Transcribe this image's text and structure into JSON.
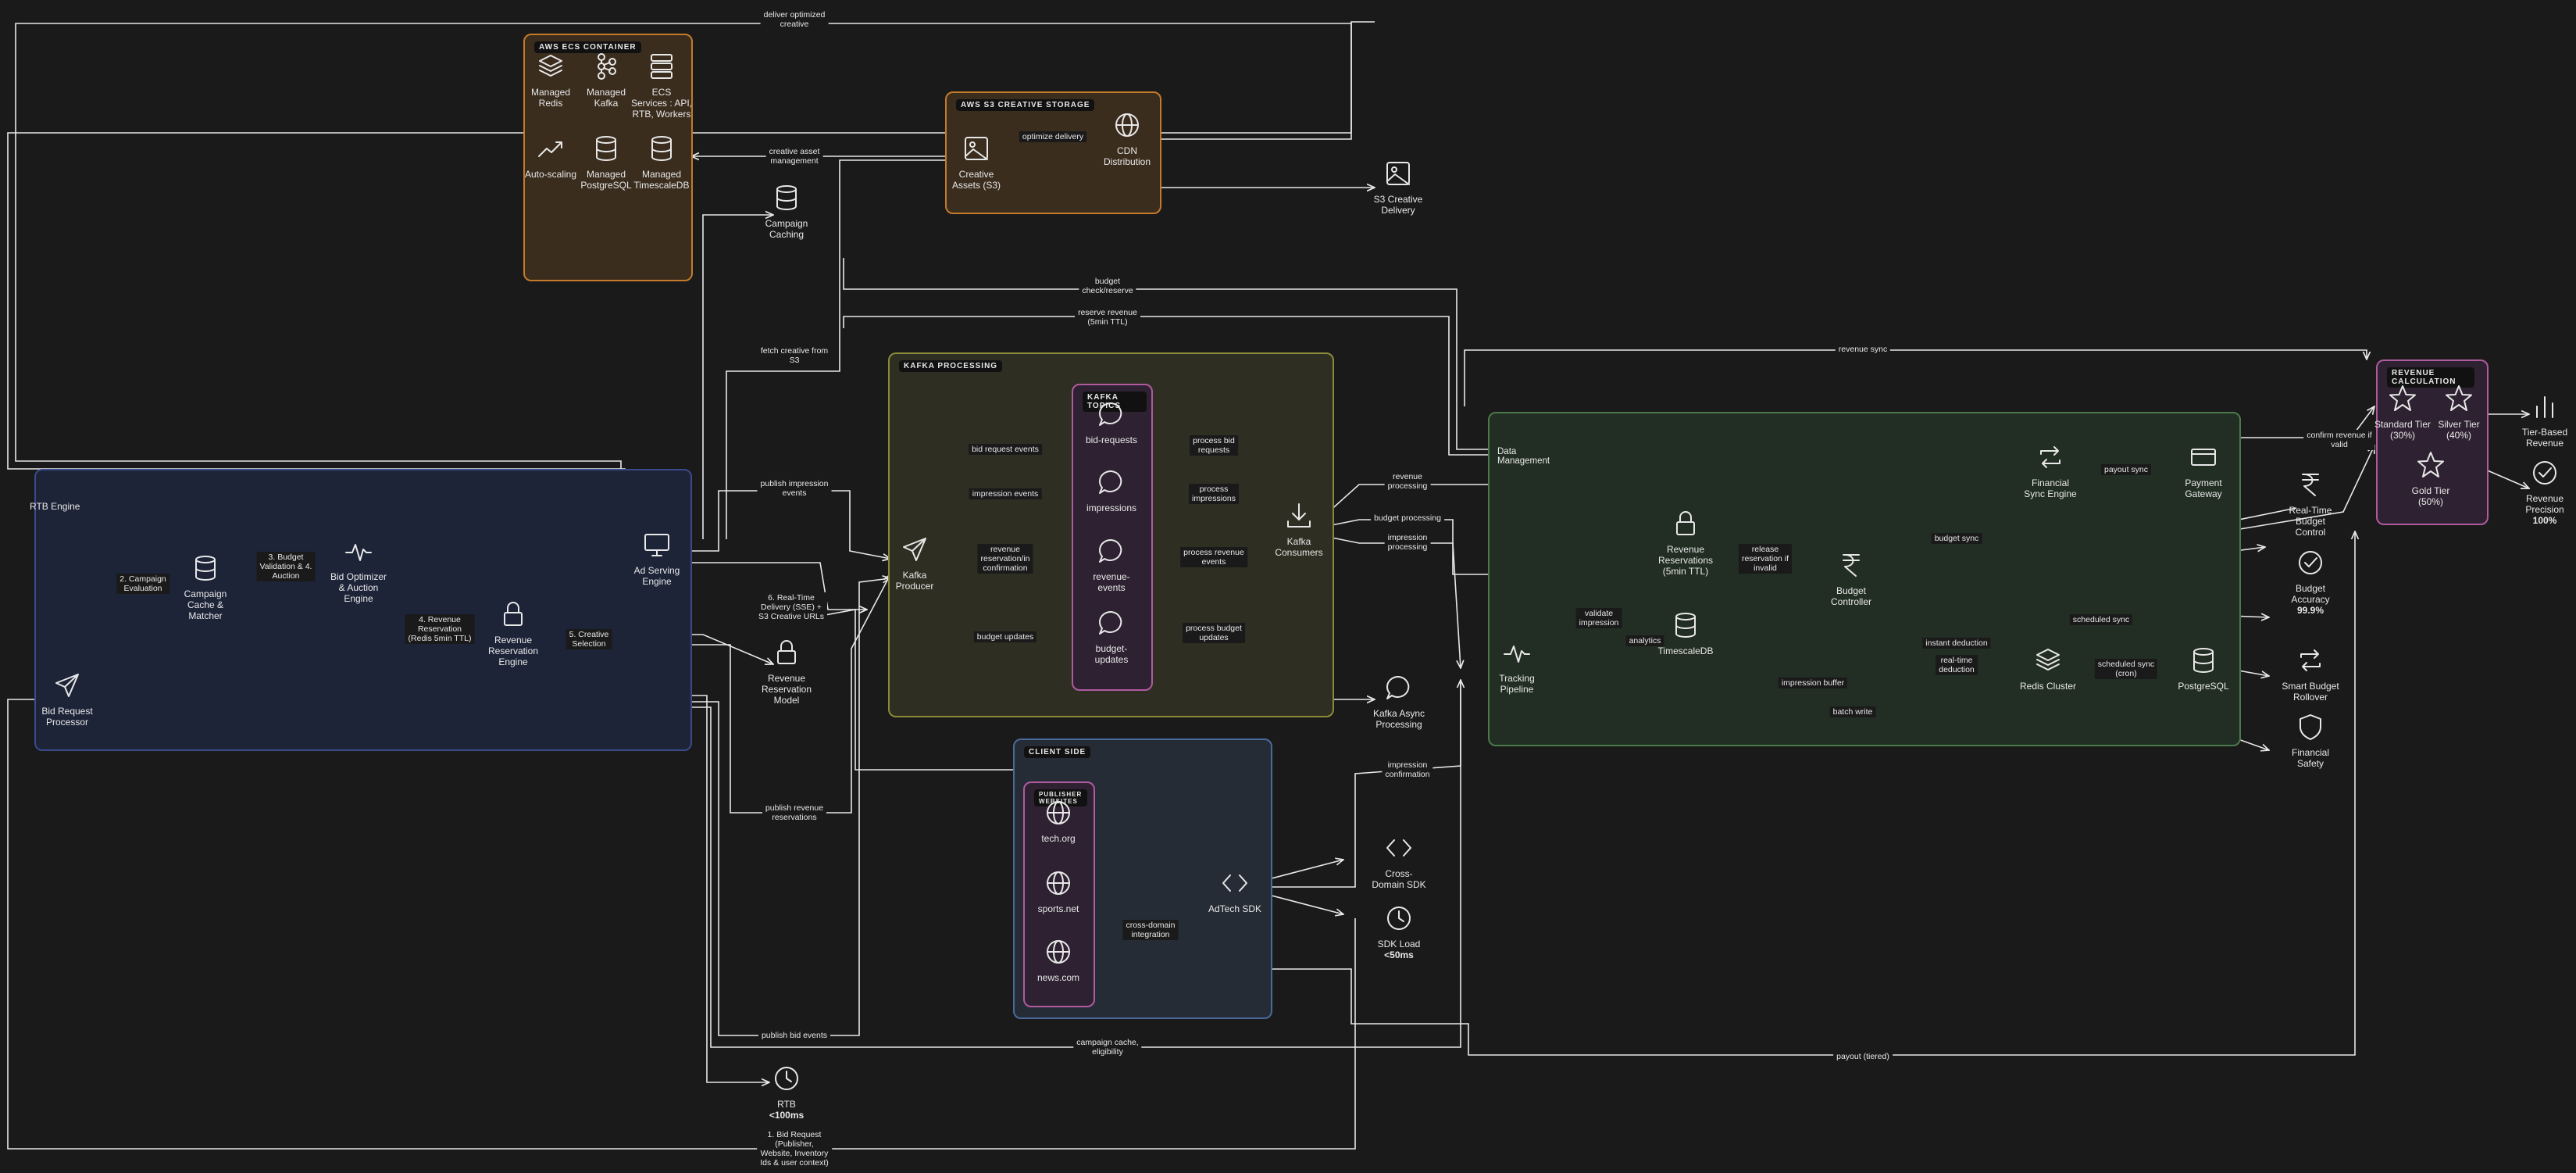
{
  "groups": {
    "ecs": {
      "title": "AWS ECS CONTAINER",
      "color": "#c47a2a",
      "fill": "#3a2d1e"
    },
    "s3": {
      "title": "AWS S3 CREATIVE STORAGE",
      "color": "#c47a2a",
      "fill": "#3a2d1e"
    },
    "kafka": {
      "title": "KAFKA PROCESSING",
      "color": "#8a8a3a",
      "fill": "#2e2e22"
    },
    "topics": {
      "title": "KAFKA TOPICS",
      "color": "#b05aa0",
      "fill": "#2e2232"
    },
    "rtb": {
      "title": "RTB Engine",
      "color": "#3a4a8a",
      "fill": "#1d2438"
    },
    "client": {
      "title": "CLIENT SIDE",
      "color": "#4a6a9a",
      "fill": "#252c36"
    },
    "publishers": {
      "title": "PUBLISHER WEBSITES",
      "color": "#b05aa0",
      "fill": "#2e2232"
    },
    "data": {
      "title": "Data Management",
      "color": "#4a7a4a",
      "fill": "#222e24"
    },
    "revenue": {
      "title": "REVENUE CALCULATION",
      "color": "#b05aa0",
      "fill": "#2e2232"
    }
  },
  "nodes": {
    "redis_managed": {
      "label": "Managed\nRedis",
      "icon": "layers-icon"
    },
    "kafka_managed": {
      "label": "Managed\nKafka",
      "icon": "kafka-icon"
    },
    "ecs_services": {
      "label": "ECS\nServices : API,\nRTB, Workers",
      "icon": "server-icon"
    },
    "autoscaling": {
      "label": "Auto-scaling",
      "icon": "trend-icon"
    },
    "postgres_managed": {
      "label": "Managed\nPostgreSQL",
      "icon": "database-icon"
    },
    "timescale_managed": {
      "label": "Managed\nTimescaleDB",
      "icon": "database-icon"
    },
    "creative_assets": {
      "label": "Creative\nAssets (S3)",
      "icon": "image-icon"
    },
    "cdn": {
      "label": "CDN\nDistribution",
      "icon": "globe-icon"
    },
    "s3_delivery": {
      "label": "S3 Creative\nDelivery",
      "icon": "image-icon"
    },
    "campaign_caching": {
      "label": "Campaign\nCaching",
      "icon": "database-icon"
    },
    "bid_processor": {
      "label": "Bid Request\nProcessor",
      "icon": "send-icon"
    },
    "campaign_cache": {
      "label": "Campaign\nCache &\nMatcher",
      "icon": "database-icon"
    },
    "bid_optimizer": {
      "label": "Bid Optimizer\n& Auction\nEngine",
      "icon": "pulse-icon"
    },
    "revenue_engine": {
      "label": "Revenue\nReservation\nEngine",
      "icon": "lock-icon"
    },
    "ad_serving": {
      "label": "Ad Serving\nEngine",
      "icon": "monitor-icon"
    },
    "revenue_model": {
      "label": "Revenue\nReservation\nModel",
      "icon": "lock-icon"
    },
    "kafka_producer": {
      "label": "Kafka\nProducer",
      "icon": "send-icon"
    },
    "topic_bid": {
      "label": "bid-requests",
      "icon": "chat-icon"
    },
    "topic_imp": {
      "label": "impressions",
      "icon": "chat-icon"
    },
    "topic_rev": {
      "label": "revenue-\nevents",
      "icon": "chat-icon"
    },
    "topic_budget": {
      "label": "budget-\nupdates",
      "icon": "chat-icon"
    },
    "kafka_consumers": {
      "label": "Kafka\nConsumers",
      "icon": "download-icon"
    },
    "kafka_async": {
      "label": "Kafka Async\nProcessing",
      "icon": "chat-icon"
    },
    "tech_org": {
      "label": "tech.org",
      "icon": "globe-icon"
    },
    "sports_net": {
      "label": "sports.net",
      "icon": "globe-icon"
    },
    "news_com": {
      "label": "news.com",
      "icon": "globe-icon"
    },
    "adtech_sdk": {
      "label": "AdTech SDK",
      "icon": "code-icon"
    },
    "cross_sdk": {
      "label": "Cross-\nDomain SDK",
      "icon": "code-icon"
    },
    "sdk_load": {
      "label": "SDK Load",
      "sub": "&lt;50ms",
      "icon": "clock-icon"
    },
    "rtb_latency": {
      "label": "RTB",
      "sub": "&lt;100ms",
      "icon": "clock-icon"
    },
    "tracking": {
      "label": "Tracking\nPipeline",
      "icon": "pulse-icon"
    },
    "timescale": {
      "label": "TimescaleDB",
      "icon": "database-icon"
    },
    "rev_reservations": {
      "label": "Revenue\nReservations\n(5min TTL)",
      "icon": "lock-icon"
    },
    "budget_controller": {
      "label": "Budget\nController",
      "icon": "rupee-icon"
    },
    "fin_sync": {
      "label": "Financial\nSync Engine",
      "icon": "repeat-icon"
    },
    "payment": {
      "label": "Payment\nGateway",
      "icon": "card-icon"
    },
    "redis_cluster": {
      "label": "Redis Cluster",
      "icon": "layers-icon"
    },
    "postgresql": {
      "label": "PostgreSQL",
      "icon": "database-icon"
    },
    "standard_tier": {
      "label": "Standard Tier\n(30%)",
      "icon": "star-icon"
    },
    "silver_tier": {
      "label": "Silver Tier\n(40%)",
      "icon": "star-icon"
    },
    "gold_tier": {
      "label": "Gold Tier\n(50%)",
      "icon": "star-icon"
    },
    "tier_revenue": {
      "label": "Tier-Based\nRevenue",
      "icon": "bars-icon"
    },
    "rev_precision": {
      "label": "Revenue\nPrecision",
      "sub": "100%",
      "icon": "check-icon"
    },
    "rt_budget": {
      "label": "Real-Time\nBudget\nControl",
      "icon": "rupee-icon"
    },
    "budget_accuracy": {
      "label": "Budget\nAccuracy",
      "sub": "99.9%",
      "icon": "check-icon"
    },
    "smart_rollover": {
      "label": "Smart Budget\nRollover",
      "icon": "repeat-icon"
    },
    "fin_safety": {
      "label": "Financial\nSafety",
      "icon": "shield-icon"
    }
  },
  "edges": {
    "e1": "deliver optimized\ncreative",
    "e2": "creative asset\nmanagement",
    "e3": "optimize delivery",
    "e4": "budget\ncheck/reserve",
    "e5": "reserve revenue\n(5min TTL)",
    "e6": "fetch creative from\nS3",
    "e7": "revenue sync",
    "e8": "publish impression\nevents",
    "e9": "6. Real-Time\nDelivery (SSE) +\nS3 Creative URLs",
    "e10": "2. Campaign\nEvaluation",
    "e11": "3. Budget\nValidation & 4.\nAuction",
    "e12": "4. Revenue\nReservation\n(Redis 5min TTL)",
    "e13": "5. Creative\nSelection",
    "e14": "bid request events",
    "e15": "impression events",
    "e16": "revenue\nreservation/in\nconfirmation",
    "e17": "budget updates",
    "e18": "process bid\nrequests",
    "e19": "process\nimpressions",
    "e20": "process revenue\nevents",
    "e21": "process budget\nupdates",
    "e22": "revenue\nprocessing",
    "e23": "budget processing",
    "e24": "impression\nprocessing",
    "e25": "payout sync",
    "e26": "confirm revenue if\nvalid",
    "e27": "budget sync",
    "e28": "release\nreservation if\ninvalid",
    "e29": "validate\nimpression",
    "e30": "analytics",
    "e31": "instant deduction",
    "e32": "real-time\ndeduction",
    "e33": "scheduled sync",
    "e34": "scheduled sync\n(cron)",
    "e35": "impression buffer",
    "e36": "batch write",
    "e37": "publish revenue\nreservations",
    "e38": "impression\nconfirmation",
    "e39": "cross-domain\nintegration",
    "e40": "publish bid events",
    "e41": "campaign cache,\neligibility",
    "e42": "payout (tiered)",
    "e43": "1. Bid Request\n(Publisher,\nWebsite, Inventory\nIds & user context)"
  },
  "colors": {
    "background": "#1a1a1a",
    "line": "#e8e8e8",
    "text": "#e8e8e8"
  }
}
